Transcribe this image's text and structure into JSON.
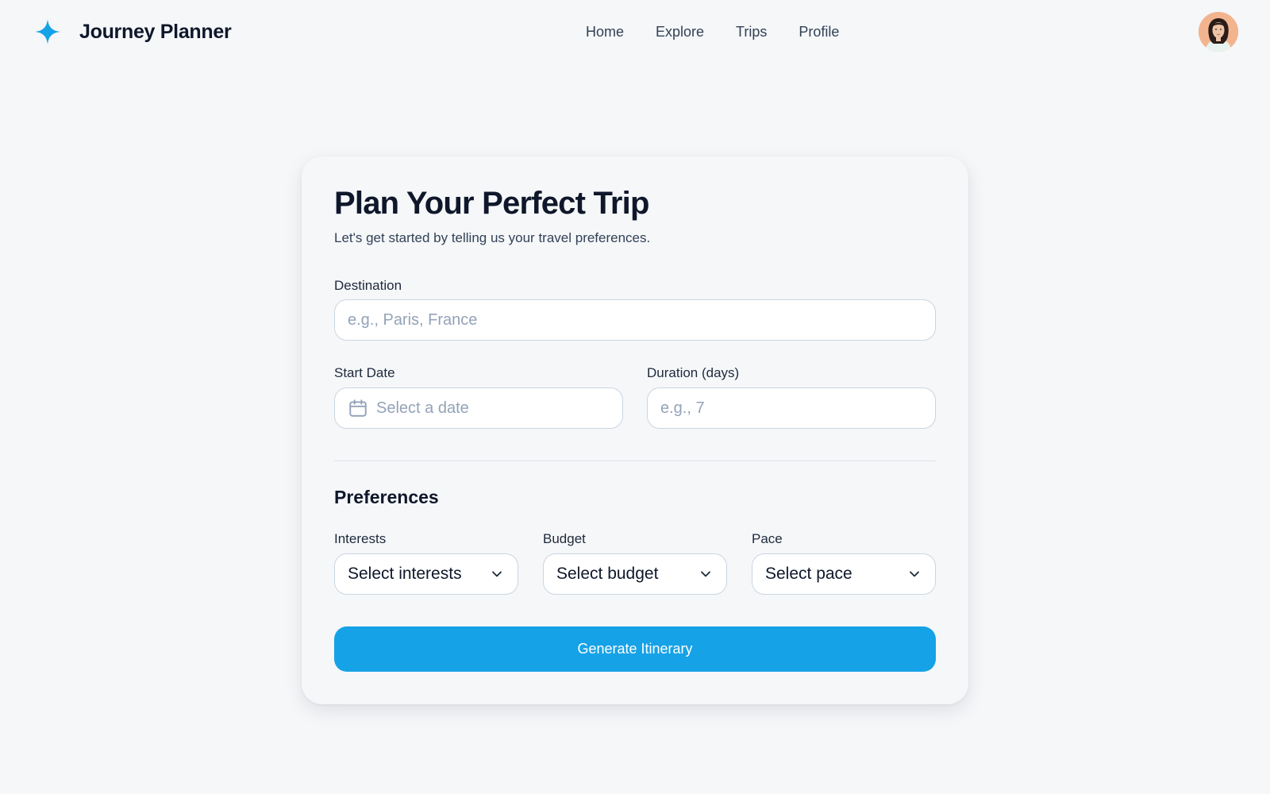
{
  "header": {
    "brand_name": "Journey Planner",
    "brand_icon": "sparkle-star-icon",
    "accent_color": "#16a2e6",
    "nav": [
      "Home",
      "Explore",
      "Trips",
      "Profile"
    ]
  },
  "card": {
    "title": "Plan Your Perfect Trip",
    "subtitle": "Let's get started by telling us your travel preferences.",
    "destination": {
      "label": "Destination",
      "value": "",
      "placeholder": "e.g., Paris, France"
    },
    "start_date": {
      "label": "Start Date",
      "value": "",
      "placeholder": "Select a date",
      "icon": "calendar-icon"
    },
    "duration": {
      "label": "Duration (days)",
      "value": "",
      "placeholder": "e.g., 7"
    },
    "preferences": {
      "title": "Preferences",
      "interests": {
        "label": "Interests",
        "value": "Select interests"
      },
      "budget": {
        "label": "Budget",
        "value": "Select budget"
      },
      "pace": {
        "label": "Pace",
        "value": "Select pace"
      }
    },
    "generate_button": "Generate Itinerary"
  }
}
